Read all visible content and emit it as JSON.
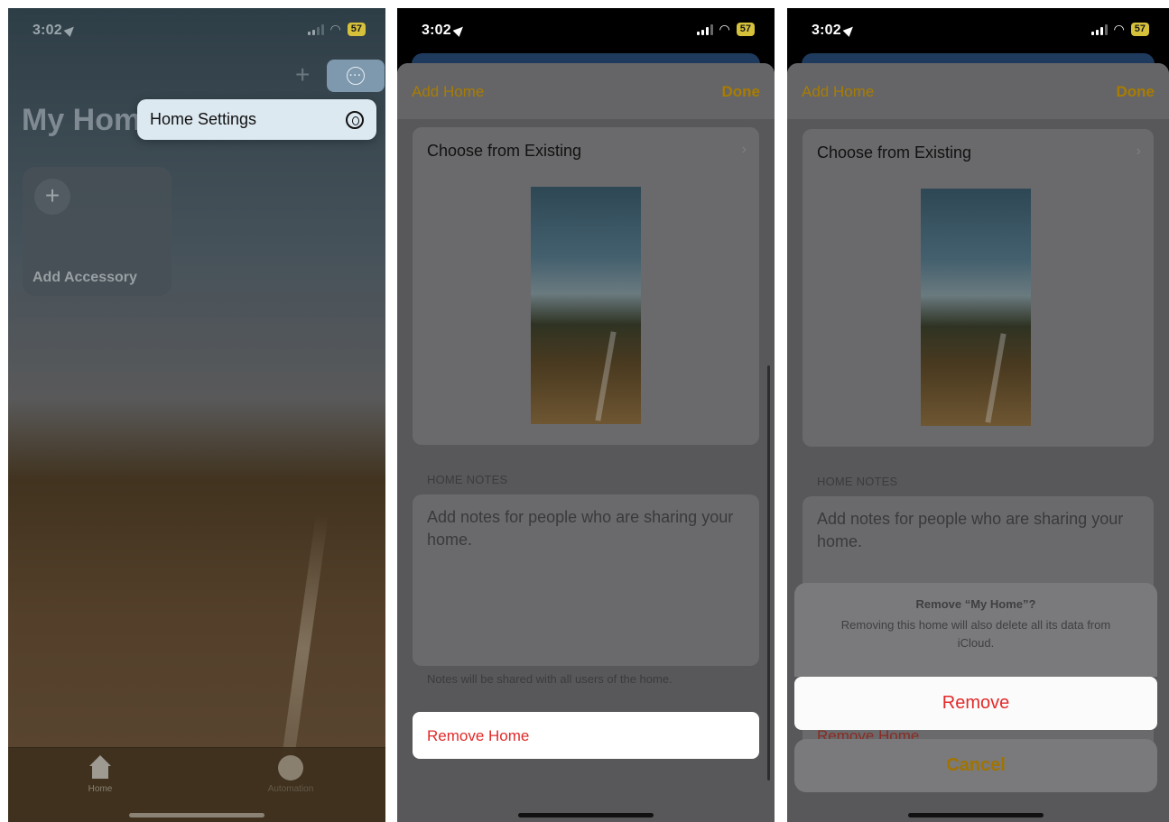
{
  "status": {
    "time": "3:02",
    "battery": "57"
  },
  "panel1": {
    "title": "My Home",
    "menu": {
      "home_settings": "Home Settings"
    },
    "tile": {
      "label": "Add Accessory"
    },
    "tabs": [
      {
        "label": "Home"
      },
      {
        "label": "Automation"
      }
    ]
  },
  "sheet": {
    "left_action": "Add Home",
    "right_action": "Done",
    "choose_existing": "Choose from Existing",
    "notes_header": "HOME NOTES",
    "notes_placeholder": "Add notes for people who are sharing your home.",
    "notes_footer": "Notes will be shared with all users of the home.",
    "remove_home": "Remove Home"
  },
  "alert": {
    "title": "Remove “My Home”?",
    "message": "Removing this home will also delete all its data from iCloud.",
    "remove": "Remove",
    "cancel": "Cancel"
  },
  "colors": {
    "accent": "#a97c00",
    "destructive": "#e22a2a"
  }
}
